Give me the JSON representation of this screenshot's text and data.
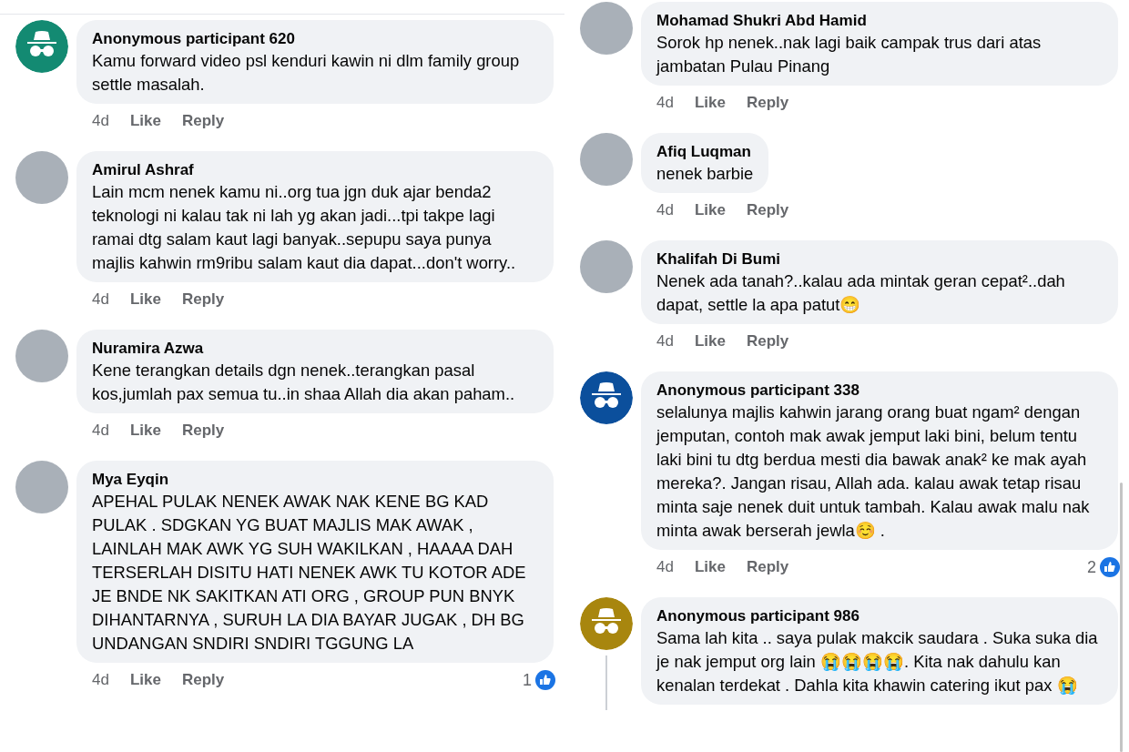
{
  "columns": [
    {
      "comments": [
        {
          "author": "Anonymous participant 620",
          "avatar": {
            "kind": "anonymous",
            "color": "#138a72"
          },
          "text": "Kamu forward video psl kenduri kawin ni dlm family group settle masalah.",
          "time": "4d",
          "like": "Like",
          "reply": "Reply"
        },
        {
          "author": "Amirul Ashraf",
          "avatar": {
            "kind": "photo"
          },
          "text": "Lain mcm nenek kamu ni..org tua jgn duk ajar benda2 teknologi ni kalau tak ni lah yg akan jadi...tpi takpe lagi ramai dtg salam kaut lagi banyak..sepupu saya punya majlis kahwin rm9ribu salam kaut dia dapat...don't worry..",
          "time": "4d",
          "like": "Like",
          "reply": "Reply"
        },
        {
          "author": "Nuramira Azwa",
          "avatar": {
            "kind": "photo"
          },
          "text": "Kene terangkan details dgn nenek..terangkan pasal kos,jumlah pax semua tu..in shaa Allah dia akan paham..",
          "time": "4d",
          "like": "Like",
          "reply": "Reply"
        },
        {
          "author": "Mya Eyqin",
          "avatar": {
            "kind": "photo"
          },
          "text": "APEHAL PULAK NENEK AWAK NAK KENE BG KAD PULAK . SDGKAN YG BUAT MAJLIS MAK AWAK , LAINLAH MAK AWK YG SUH WAKILKAN , HAAAA DAH TERSERLAH DISITU HATI NENEK AWK TU KOTOR ADE JE BNDE NK SAKITKAN ATI ORG , GROUP PUN BNYK DIHANTARNYA , SURUH LA DIA BAYAR JUGAK , DH BG UNDANGAN SNDIRI SNDIRI TGGUNG LA",
          "time": "4d",
          "like": "Like",
          "reply": "Reply",
          "reactions": "1"
        }
      ]
    },
    {
      "comments": [
        {
          "author": "Mohamad Shukri Abd Hamid",
          "avatar": {
            "kind": "photo"
          },
          "text": "Sorok hp nenek..nak lagi baik campak trus dari atas jambatan Pulau Pinang",
          "time": "4d",
          "like": "Like",
          "reply": "Reply"
        },
        {
          "author": "Afiq Luqman",
          "avatar": {
            "kind": "photo"
          },
          "text": "nenek barbie",
          "time": "4d",
          "like": "Like",
          "reply": "Reply"
        },
        {
          "author": "Khalifah Di Bumi",
          "avatar": {
            "kind": "photo"
          },
          "text": "Nenek ada tanah?..kalau ada mintak geran cepat²..dah dapat, settle la apa patut😁",
          "time": "4d",
          "like": "Like",
          "reply": "Reply"
        },
        {
          "author": "Anonymous participant 338",
          "avatar": {
            "kind": "anonymous",
            "color": "#0b4f9c"
          },
          "text": "selalunya majlis kahwin jarang orang buat ngam² dengan jemputan, contoh mak awak jemput laki bini, belum tentu laki bini tu dtg berdua mesti dia bawak anak² ke mak ayah mereka?. Jangan risau, Allah ada. kalau awak tetap risau minta saje nenek duit untuk tambah. Kalau awak malu nak minta awak berserah jewla☺️ .",
          "time": "4d",
          "like": "Like",
          "reply": "Reply",
          "reactions": "2"
        },
        {
          "author": "Anonymous participant 986",
          "avatar": {
            "kind": "anonymous",
            "color": "#a8860e"
          },
          "text": "Sama lah kita .. saya pulak makcik saudara . Suka suka dia je nak jemput org lain 😭😭😭😭. Kita nak dahulu kan kenalan terdekat . Dahla kita khawin catering ikut pax 😭",
          "has_replies": true
        }
      ]
    }
  ]
}
